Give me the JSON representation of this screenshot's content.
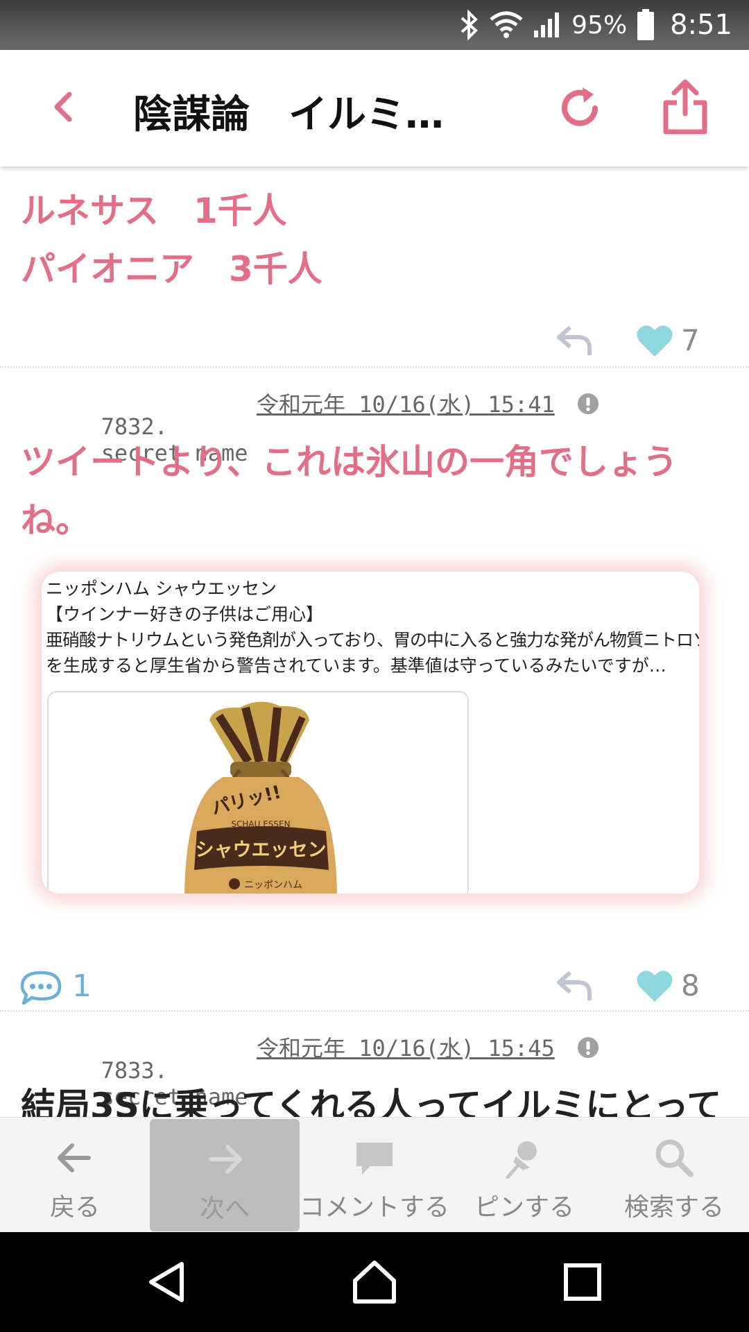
{
  "status": {
    "battery": "95%",
    "time": "8:51"
  },
  "header": {
    "title": "陰謀論　イルミ…"
  },
  "prev_post": {
    "lines": [
      "ルネサス　1千人",
      "パイオニア　3千人"
    ],
    "likes": "7"
  },
  "post_7832": {
    "number": "7832.",
    "name": "secret name",
    "date": "令和元年 10/16(水) 15:41",
    "body_line1": "ツイートより、これは氷山の一角でしょう",
    "body_line2": "ね。",
    "tweet_lines": [
      "ニッポンハム シャウエッセン",
      "【ウインナー好きの子供はご用心】",
      "亜硝酸ナトリウムという発色剤が入っており、胃の中に入ると強力な発がん物質ニトロソアミン",
      "を生成すると厚生省から警告されています。基準値は守っているみたいですが…"
    ],
    "package_text": "シャウエッセン",
    "package_sub": "SCHAU ESSEN",
    "package_burst": "パリッ!!",
    "package_brand": "ニッポンハム",
    "comments": "1",
    "likes": "8"
  },
  "post_7833": {
    "number": "7833.",
    "name": "secret name",
    "date": "令和元年 10/16(水) 15:45",
    "body_line1": "結局3Sに乗ってくれる人ってイルミにとって"
  },
  "toolbar": {
    "back": "戻る",
    "next": "次へ",
    "comment": "コメントする",
    "pin": "ピンする",
    "search": "検索する"
  },
  "colors": {
    "accent_pink": "#e26f87",
    "like_teal": "#8fd6df",
    "comment_blue": "#6ab0d8"
  },
  "icons": [
    "bluetooth-icon",
    "wifi-icon",
    "signal-icon",
    "battery-icon",
    "back-icon",
    "reload-icon",
    "share-icon",
    "reply-icon",
    "heart-icon",
    "report-icon",
    "comment-icon",
    "arrow-left-icon",
    "arrow-right-icon",
    "speech-bubble-icon",
    "pin-icon",
    "search-icon",
    "nav-back-icon",
    "nav-home-icon",
    "nav-recents-icon"
  ]
}
